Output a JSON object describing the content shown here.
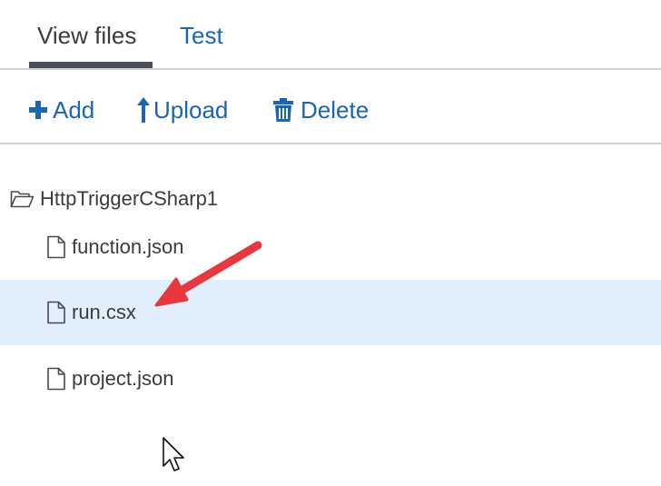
{
  "tabs": [
    {
      "label": "View files",
      "active": true
    },
    {
      "label": "Test",
      "active": false
    }
  ],
  "toolbar": {
    "add_label": "Add",
    "upload_label": "Upload",
    "delete_label": "Delete"
  },
  "tree": {
    "folder": {
      "label": "HttpTriggerCSharp1",
      "icon": "folder-open-icon"
    },
    "files": [
      {
        "label": "function.json",
        "icon": "file-icon",
        "selected": false
      },
      {
        "label": "run.csx",
        "icon": "file-icon",
        "selected": true
      },
      {
        "label": "project.json",
        "icon": "file-icon",
        "selected": false
      }
    ]
  },
  "colors": {
    "accent": "#1a66b3",
    "text": "#3b3b3b",
    "selected_row": "#e1eefb",
    "arrow": "#e8383d",
    "tab_underline": "#4a4f57",
    "divider": "#cfcfcf"
  }
}
